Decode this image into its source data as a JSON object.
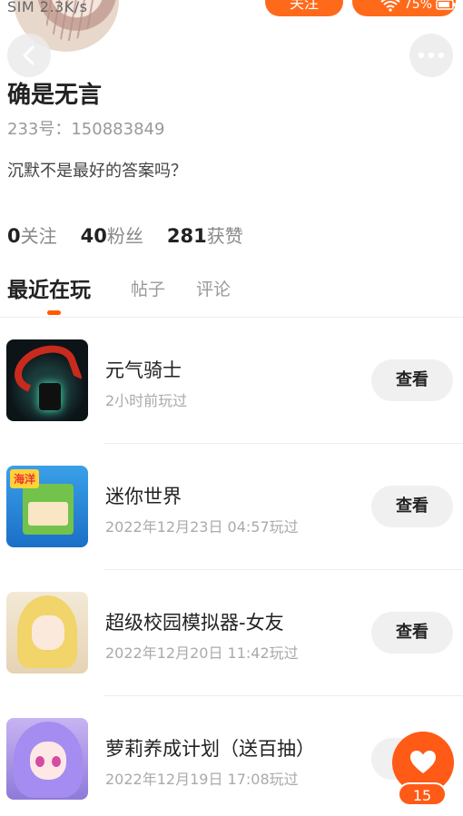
{
  "status_bar": {
    "left_text": "SIM 2.3K/s",
    "battery": "75%"
  },
  "header": {
    "follow_label": "关注",
    "back_icon": "chevron-left-icon",
    "more_icon": "more-dots-icon"
  },
  "profile": {
    "name": "确是无言",
    "uid": "233号：150883849",
    "bio": "沉默不是最好的答案吗？",
    "stats": [
      {
        "num": "0",
        "label": "关注"
      },
      {
        "num": "40",
        "label": "粉丝"
      },
      {
        "num": "281",
        "label": "获赞"
      }
    ]
  },
  "tabs": [
    {
      "label": "最近在玩",
      "active": true
    },
    {
      "label": "帖子",
      "active": false
    },
    {
      "label": "评论",
      "active": false
    }
  ],
  "games": [
    {
      "title": "元气骑士",
      "time": "2小时前玩过",
      "button": "查看",
      "icon": "soul-knight-icon"
    },
    {
      "title": "迷你世界",
      "time": "2022年12月23日 04:57玩过",
      "button": "查看",
      "icon": "mini-world-icon",
      "icon_tag": "海洋"
    },
    {
      "title": "超级校园模拟器-女友",
      "time": "2022年12月20日 11:42玩过",
      "button": "查看",
      "icon": "school-sim-icon"
    },
    {
      "title": "萝莉养成计划（送百抽）",
      "time": "2022年12月19日 17:08玩过",
      "button": "查看",
      "icon": "loli-plan-icon"
    }
  ],
  "like": {
    "count": "15",
    "icon": "heart-icon"
  },
  "colors": {
    "accent": "#ff5a16",
    "button_bg": "#f0f0f0"
  }
}
